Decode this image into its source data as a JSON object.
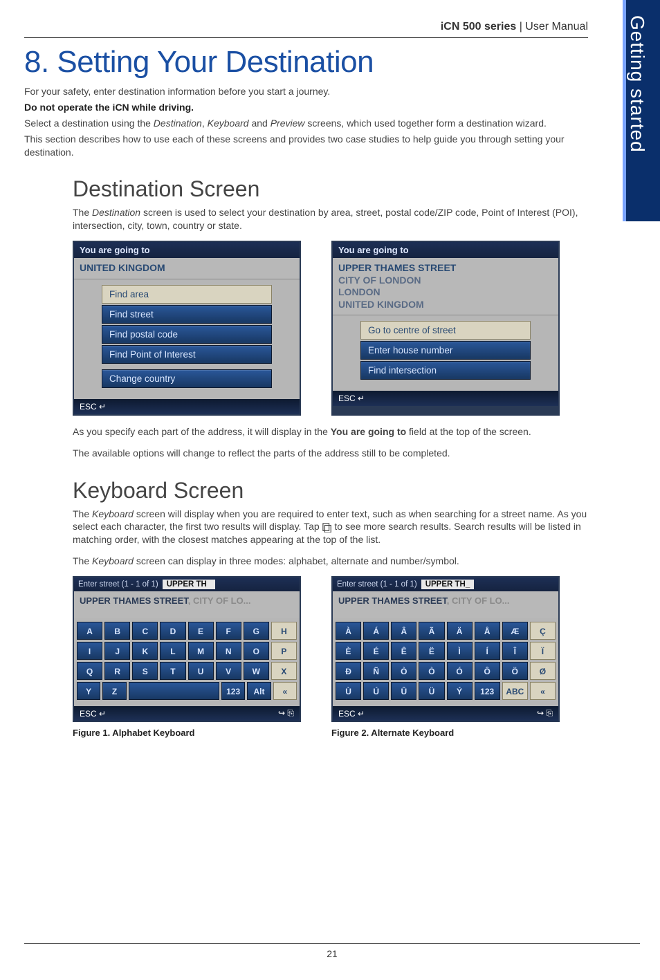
{
  "header": {
    "title_bold": "iCN 500 series",
    "title_rest": " | User Manual"
  },
  "side_tab": "Getting started",
  "chapter_title": "8. Setting Your Destination",
  "intro": {
    "p1": "For your safety, enter destination information before you start a journey.",
    "warn": "Do not operate the iCN while driving.",
    "p2a": "Select a destination using the ",
    "p2b": "Destination",
    "p2c": ", ",
    "p2d": "Keyboard",
    "p2e": " and ",
    "p2f": "Preview",
    "p2g": " screens, which used together form a destination wizard.",
    "p3": "This section describes how to use each of these screens and provides two case studies to help guide you through setting your destination."
  },
  "section1": {
    "title": "Destination Screen",
    "desc_a": "The ",
    "desc_b": "Destination",
    "desc_c": " screen is used to select your destination by area, street, postal code/ZIP code, Point of Interest (POI), intersection, city, town, country or state.",
    "left": {
      "title": "You are going to",
      "context": "UNITED KINGDOM",
      "items": [
        "Find area",
        "Find street",
        "Find postal code",
        "Find Point of Interest",
        "Change country"
      ],
      "open_index": 0,
      "gap_index": 4,
      "footer_esc": "ESC ↵"
    },
    "right": {
      "title": "You are going to",
      "context_lines": [
        "UPPER THAMES STREET",
        "CITY OF LONDON",
        "LONDON",
        "UNITED KINGDOM"
      ],
      "items": [
        "Go to centre of street",
        "Enter house number",
        "Find intersection"
      ],
      "open_index": 0,
      "footer_esc": "ESC ↵"
    },
    "after1a": "As you specify each part of the address, it will display in the ",
    "after1b": "You are going to",
    "after1c": " field at the top of the screen.",
    "after2": "The available options will change to reflect the parts of the address still to be completed."
  },
  "section2": {
    "title": "Keyboard Screen",
    "desc_a": "The ",
    "desc_b": "Keyboard",
    "desc_c": " screen will display when you are required to enter text, such as when searching for a street name. As you select each character, the first two results will display. Tap ",
    "desc_d": " to see more search results. Search results will be listed in matching order, with the closest matches appearing at the top of the list.",
    "desc2_a": "The ",
    "desc2_b": "Keyboard",
    "desc2_c": " screen can display in three modes: alphabet, alternate and number/symbol.",
    "kb1": {
      "top_label": "Enter street (1 - 1 of 1)",
      "entry": "UPPER TH",
      "result_bold": "UPPER THAMES STREET",
      "result_dim": ", CITY OF LO...",
      "rows": [
        [
          "A",
          "B",
          "C",
          "D",
          "E",
          "F",
          "G",
          "H"
        ],
        [
          "I",
          "J",
          "K",
          "L",
          "M",
          "N",
          "O",
          "P"
        ],
        [
          "Q",
          "R",
          "S",
          "T",
          "U",
          "V",
          "W",
          "X"
        ]
      ],
      "last_row_left": [
        "Y",
        "Z"
      ],
      "last_row_right": [
        "123",
        "Alt",
        "«"
      ],
      "open_keys": [
        "H",
        "P",
        "X",
        "«"
      ],
      "footer_esc": "ESC ↵",
      "footer_right": "↪ ⎘",
      "caption": "Figure 1. Alphabet Keyboard"
    },
    "kb2": {
      "top_label": "Enter street (1 - 1 of 1)",
      "entry": "UPPER TH_",
      "result_bold": "UPPER THAMES STREET",
      "result_dim": ", CITY OF LO...",
      "rows": [
        [
          "À",
          "Á",
          "Â",
          "Ã",
          "Ä",
          "Å",
          "Æ",
          "Ç"
        ],
        [
          "È",
          "É",
          "Ê",
          "Ë",
          "Ì",
          "Í",
          "Î",
          "Ï"
        ],
        [
          "Ð",
          "Ñ",
          "Ò",
          "Ò",
          "Ó",
          "Ô",
          "Ö",
          "Ø"
        ],
        [
          "Ù",
          "Ú",
          "Û",
          "Ü",
          "Ý",
          "123",
          "ABC",
          "«"
        ]
      ],
      "open_keys": [
        "Ç",
        "Ï",
        "Ø",
        "ABC",
        "«"
      ],
      "footer_esc": "ESC ↵",
      "footer_right": "↪ ⎘",
      "caption": "Figure 2. Alternate Keyboard"
    }
  },
  "page_number": "21"
}
